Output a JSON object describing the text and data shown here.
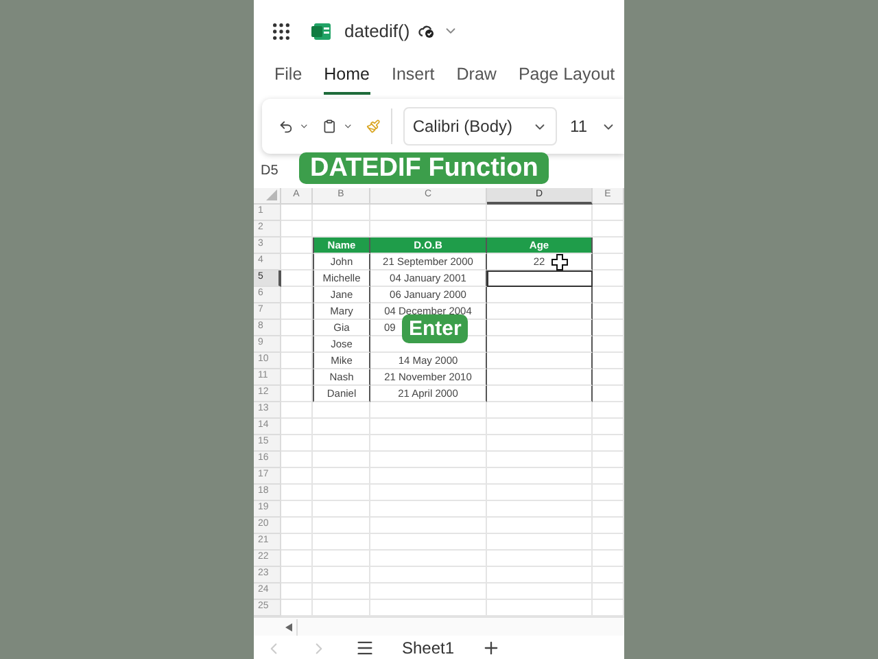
{
  "app": {
    "title": "datedif()"
  },
  "tabs": [
    {
      "label": "File",
      "selected": false
    },
    {
      "label": "Home",
      "selected": true
    },
    {
      "label": "Insert",
      "selected": false
    },
    {
      "label": "Draw",
      "selected": false
    },
    {
      "label": "Page Layout",
      "selected": false
    }
  ],
  "toolbar": {
    "font": "Calibri (Body)",
    "size": "11"
  },
  "name_box": "D5",
  "overlay_title": "DATEDIF Function",
  "overlay_hint": "Enter",
  "sheet": {
    "columns": [
      {
        "label": "A",
        "selected": false
      },
      {
        "label": "B",
        "selected": false
      },
      {
        "label": "C",
        "selected": false
      },
      {
        "label": "D",
        "selected": true
      },
      {
        "label": "E",
        "selected": false
      }
    ],
    "rows": [
      {
        "number": "1",
        "selected": false
      },
      {
        "number": "2",
        "selected": false
      },
      {
        "number": "3",
        "selected": false
      },
      {
        "number": "4",
        "selected": false
      },
      {
        "number": "5",
        "selected": true
      },
      {
        "number": "6",
        "selected": false
      },
      {
        "number": "7",
        "selected": false
      },
      {
        "number": "8",
        "selected": false
      },
      {
        "number": "9",
        "selected": false
      },
      {
        "number": "10",
        "selected": false
      },
      {
        "number": "11",
        "selected": false
      },
      {
        "number": "12",
        "selected": false
      },
      {
        "number": "13",
        "selected": false
      },
      {
        "number": "14",
        "selected": false
      },
      {
        "number": "15",
        "selected": false
      },
      {
        "number": "16",
        "selected": false
      },
      {
        "number": "17",
        "selected": false
      },
      {
        "number": "18",
        "selected": false
      },
      {
        "number": "19",
        "selected": false
      },
      {
        "number": "20",
        "selected": false
      },
      {
        "number": "21",
        "selected": false
      },
      {
        "number": "22",
        "selected": false
      },
      {
        "number": "23",
        "selected": false
      },
      {
        "number": "24",
        "selected": false
      },
      {
        "number": "25",
        "selected": false
      }
    ]
  },
  "table": {
    "columns": [
      "Name",
      "D.O.B",
      "Age"
    ],
    "rows": [
      {
        "cells": [
          "John",
          "21 September 2000",
          "22"
        ]
      },
      {
        "cells": [
          "Michelle",
          "04 January 2001"
        ]
      },
      {
        "cells": [
          "Jane",
          "06 January 2000"
        ]
      },
      {
        "cells": [
          "Mary",
          "04 December 2004"
        ]
      },
      {
        "cells": [
          "Gia",
          "09"
        ],
        "kind": "covered"
      },
      {
        "cells": [
          "Jose"
        ]
      },
      {
        "cells": [
          "Mike",
          "14 May 2000"
        ]
      },
      {
        "cells": [
          "Nash",
          "21 November 2010"
        ]
      },
      {
        "cells": [
          "Daniel",
          "21 April 2000"
        ]
      }
    ]
  },
  "sheet_tab": "Sheet1"
}
